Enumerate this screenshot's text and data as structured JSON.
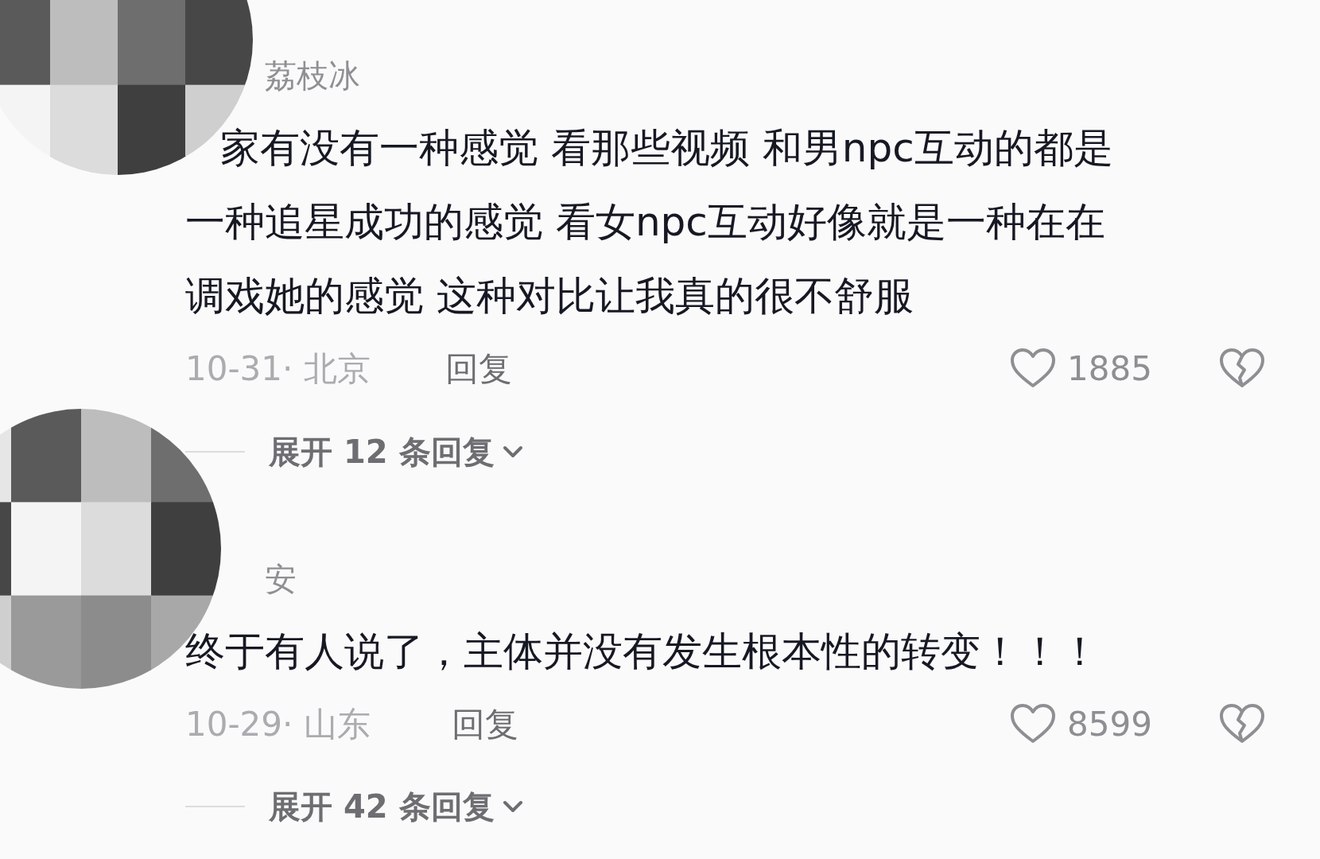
{
  "comments": [
    {
      "avatar": {
        "kind": "picture"
      },
      "username": "荔枝冰",
      "lines": [
        "家有没有一种感觉 看那些视频 和男npc互动的都是",
        "一种追星成功的感觉  看女npc互动好像就是一种在在",
        "调戏她的感觉 这种对比让我真的很不舒服"
      ],
      "date": "10-31· 北京",
      "reply": "回复",
      "likes": "1885",
      "expand": "展开 12 条回复"
    },
    {
      "avatar": {
        "kind": "picture"
      },
      "username": "安",
      "lines": [
        "终于有人说了，主体并没有发生根本性的转变！！！"
      ],
      "date": "10-29· 山东",
      "reply": "回复",
      "likes": "8599",
      "expand": "展开 42 条回复"
    }
  ]
}
